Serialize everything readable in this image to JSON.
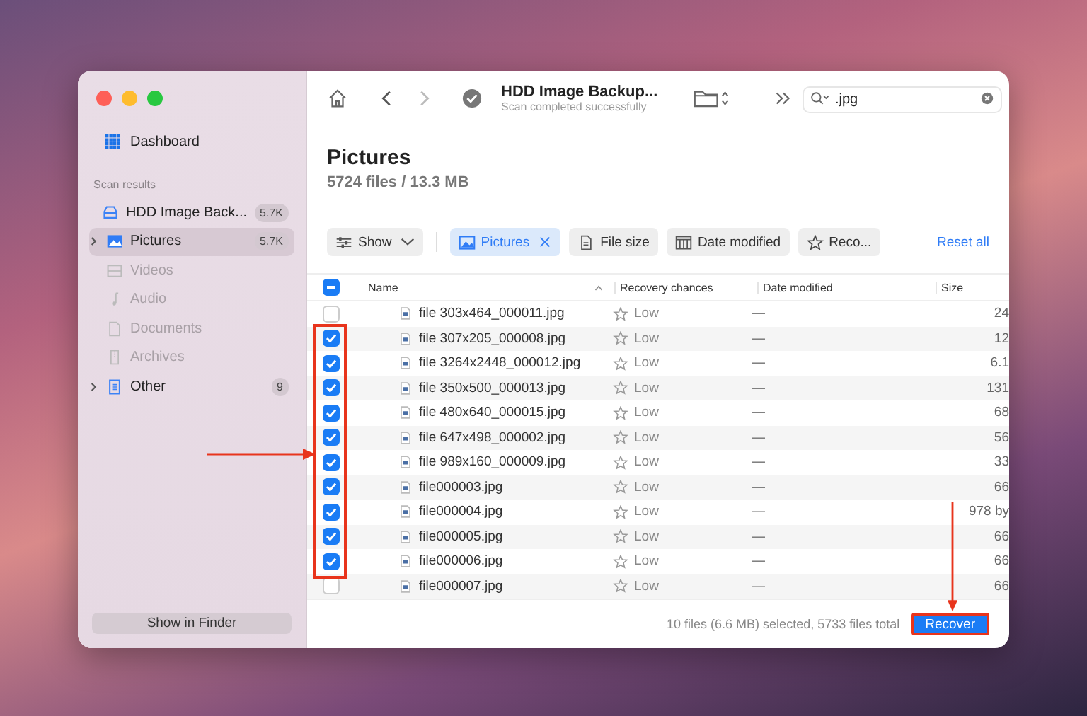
{
  "sidebar": {
    "dashboard": "Dashboard",
    "section_title": "Scan results",
    "items": [
      {
        "kind": "drive",
        "label": "HDD Image Back...",
        "count": "5.7K",
        "selected": false,
        "disabled": false,
        "expandable": false
      },
      {
        "kind": "pictures",
        "label": "Pictures",
        "count": "5.7K",
        "selected": true,
        "disabled": false,
        "expandable": true
      },
      {
        "kind": "videos",
        "label": "Videos",
        "selected": false,
        "disabled": true,
        "expandable": false
      },
      {
        "kind": "audio",
        "label": "Audio",
        "selected": false,
        "disabled": true,
        "expandable": false
      },
      {
        "kind": "documents",
        "label": "Documents",
        "selected": false,
        "disabled": true,
        "expandable": false
      },
      {
        "kind": "archives",
        "label": "Archives",
        "selected": false,
        "disabled": true,
        "expandable": false
      },
      {
        "kind": "other",
        "label": "Other",
        "count": "9",
        "selected": false,
        "disabled": false,
        "expandable": true
      }
    ],
    "show_in_finder": "Show in Finder"
  },
  "toolbar": {
    "title": "HDD Image Backup...",
    "subtitle": "Scan completed successfully",
    "search": {
      "value": ".jpg"
    }
  },
  "heading": {
    "title": "Pictures",
    "subtitle": "5724 files / 13.3 MB"
  },
  "filters": [
    {
      "kind": "show",
      "label": "Show",
      "selected": false
    },
    {
      "kind": "pictures",
      "label": "Pictures",
      "selected": true
    },
    {
      "kind": "size",
      "label": "File size",
      "selected": false
    },
    {
      "kind": "date",
      "label": "Date modified",
      "selected": false
    },
    {
      "kind": "recovery",
      "label": "Reco...",
      "selected": false
    }
  ],
  "reset_all": "Reset all",
  "table": {
    "select_all_mixed": true,
    "columns": [
      "Name",
      "Recovery chances",
      "Date modified",
      "Size"
    ],
    "rows": [
      {
        "checked": false,
        "name": "file 303x464_000011.jpg",
        "recovery": "Low",
        "date": "—",
        "size": "24"
      },
      {
        "checked": true,
        "name": "file 307x205_000008.jpg",
        "recovery": "Low",
        "date": "—",
        "size": "12"
      },
      {
        "checked": true,
        "name": "file 3264x2448_000012.jpg",
        "recovery": "Low",
        "date": "—",
        "size": "6.1"
      },
      {
        "checked": true,
        "name": "file 350x500_000013.jpg",
        "recovery": "Low",
        "date": "—",
        "size": "131"
      },
      {
        "checked": true,
        "name": "file 480x640_000015.jpg",
        "recovery": "Low",
        "date": "—",
        "size": "68"
      },
      {
        "checked": true,
        "name": "file 647x498_000002.jpg",
        "recovery": "Low",
        "date": "—",
        "size": "56"
      },
      {
        "checked": true,
        "name": "file 989x160_000009.jpg",
        "recovery": "Low",
        "date": "—",
        "size": "33"
      },
      {
        "checked": true,
        "name": "file000003.jpg",
        "recovery": "Low",
        "date": "—",
        "size": "66"
      },
      {
        "checked": true,
        "name": "file000004.jpg",
        "recovery": "Low",
        "date": "—",
        "size": "978 by"
      },
      {
        "checked": true,
        "name": "file000005.jpg",
        "recovery": "Low",
        "date": "—",
        "size": "66"
      },
      {
        "checked": true,
        "name": "file000006.jpg",
        "recovery": "Low",
        "date": "—",
        "size": "66"
      },
      {
        "checked": false,
        "name": "file000007.jpg",
        "recovery": "Low",
        "date": "—",
        "size": "66"
      }
    ]
  },
  "footer": {
    "status": "10 files (6.6 MB) selected, 5733 files total",
    "recover": "Recover"
  }
}
